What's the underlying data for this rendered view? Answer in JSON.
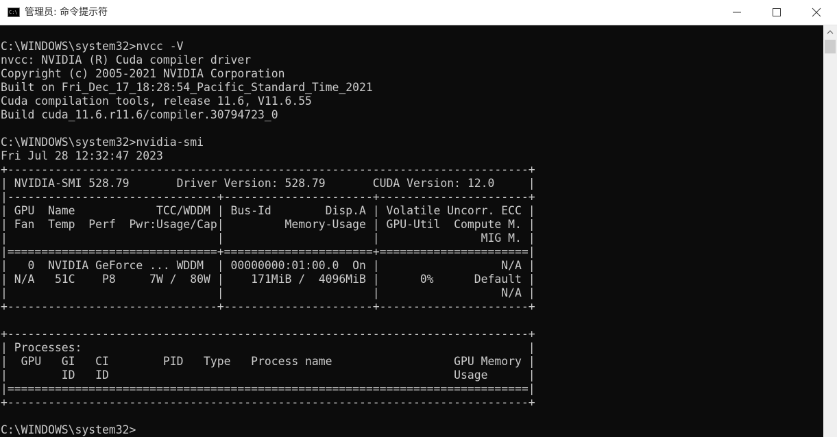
{
  "window": {
    "title": "管理员: 命令提示符",
    "icon_label": "C:\\",
    "controls": {
      "minimize_icon": "minimize-icon",
      "maximize_icon": "maximize-icon",
      "close_icon": "close-icon"
    }
  },
  "console": {
    "foreground": "#cccccc",
    "background": "#0c0c0c",
    "lines": [
      "C:\\WINDOWS\\system32>nvcc -V",
      "nvcc: NVIDIA (R) Cuda compiler driver",
      "Copyright (c) 2005-2021 NVIDIA Corporation",
      "Built on Fri_Dec_17_18:28:54_Pacific_Standard_Time_2021",
      "Cuda compilation tools, release 11.6, V11.6.55",
      "Build cuda_11.6.r11.6/compiler.30794723_0",
      "",
      "C:\\WINDOWS\\system32>nvidia-smi",
      "Fri Jul 28 12:32:47 2023",
      "+-----------------------------------------------------------------------------+",
      "| NVIDIA-SMI 528.79       Driver Version: 528.79       CUDA Version: 12.0     |",
      "|-------------------------------+----------------------+----------------------+",
      "| GPU  Name            TCC/WDDM | Bus-Id        Disp.A | Volatile Uncorr. ECC |",
      "| Fan  Temp  Perf  Pwr:Usage/Cap|         Memory-Usage | GPU-Util  Compute M. |",
      "|                               |                      |               MIG M. |",
      "|===============================+======================+======================|",
      "|   0  NVIDIA GeForce ... WDDM  | 00000000:01:00.0  On |                  N/A |",
      "| N/A   51C    P8     7W /  80W |    171MiB /  4096MiB |      0%      Default |",
      "|                               |                      |                  N/A |",
      "+-------------------------------+----------------------+----------------------+",
      "",
      "+-----------------------------------------------------------------------------+",
      "| Processes:                                                                  |",
      "|  GPU   GI   CI        PID   Type   Process name                  GPU Memory |",
      "|        ID   ID                                                   Usage      |",
      "|=============================================================================|",
      "+-----------------------------------------------------------------------------+",
      "",
      "C:\\WINDOWS\\system32>"
    ]
  },
  "scrollbar": {
    "up_icon": "scroll-up-arrow-icon"
  }
}
